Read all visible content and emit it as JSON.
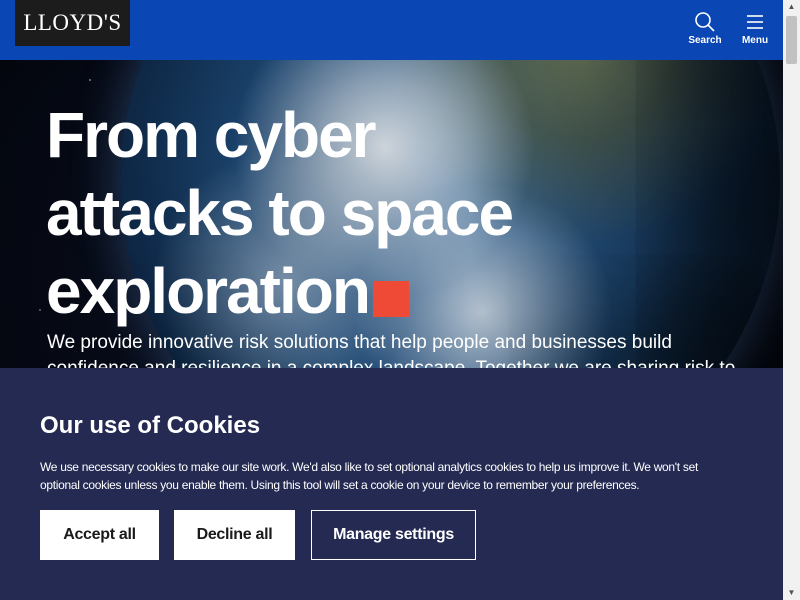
{
  "header": {
    "logo": "LLOYD'S",
    "search_label": "Search",
    "menu_label": "Menu"
  },
  "hero": {
    "title_line1": "From cyber",
    "title_line2": "attacks to space",
    "title_line3": "exploration",
    "description": "We provide innovative risk solutions that help people and businesses build confidence and resilience in a complex landscape. Together we are sharing risk to"
  },
  "cookie_banner": {
    "title": "Our use of Cookies",
    "text": "We use necessary cookies to make our site work. We'd also like to set optional analytics cookies to help us improve it. We won't set optional cookies unless you enable them. Using this tool will set a cookie on your device to remember your preferences.",
    "accept_label": "Accept all",
    "decline_label": "Decline all",
    "manage_label": "Manage settings"
  },
  "colors": {
    "header_bg": "#0a46b4",
    "cookie_bg": "#242a52",
    "accent_red": "#ee4a36"
  },
  "icons": [
    "search-icon",
    "menu-icon",
    "chevron-up-icon",
    "chevron-down-icon"
  ]
}
